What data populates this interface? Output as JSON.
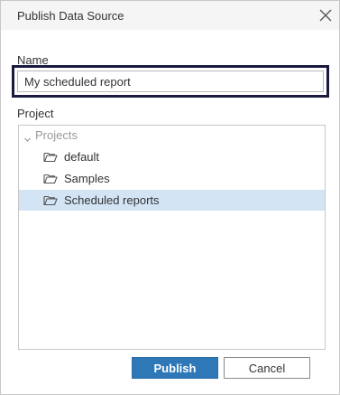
{
  "dialog": {
    "title": "Publish Data Source",
    "close_icon": "close-icon"
  },
  "name_field": {
    "label": "Name",
    "value": "My scheduled report"
  },
  "project": {
    "label": "Project",
    "root": {
      "label": "Projects",
      "expanded": true
    },
    "items": [
      {
        "label": "default",
        "icon": "folder-icon",
        "selected": false
      },
      {
        "label": "Samples",
        "icon": "folder-icon",
        "selected": false
      },
      {
        "label": "Scheduled reports",
        "icon": "folder-icon",
        "selected": true
      }
    ]
  },
  "buttons": {
    "publish": "Publish",
    "cancel": "Cancel"
  },
  "colors": {
    "accent": "#2e78b8",
    "selection": "#d3e4f5",
    "focus_border": "#1a1a3e"
  }
}
